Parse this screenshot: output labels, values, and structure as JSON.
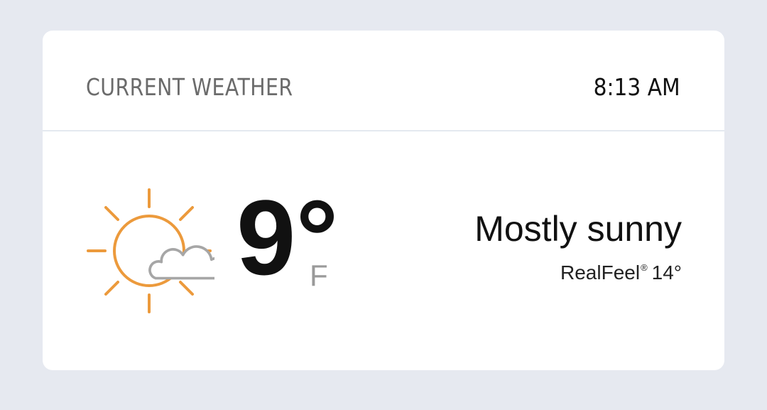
{
  "header": {
    "title": "CURRENT WEATHER",
    "time": "8:13 AM"
  },
  "current": {
    "temperature": "9°",
    "unit": "F",
    "condition": "Mostly sunny",
    "realfeel_label": "RealFeel",
    "realfeel_mark": "®",
    "realfeel_value": "14°",
    "icon": "sun-with-cloud-icon"
  },
  "colors": {
    "sun": "#ec9a3c",
    "cloud": "#a6a6a6",
    "background": "#e6e9f0",
    "card": "#ffffff"
  }
}
